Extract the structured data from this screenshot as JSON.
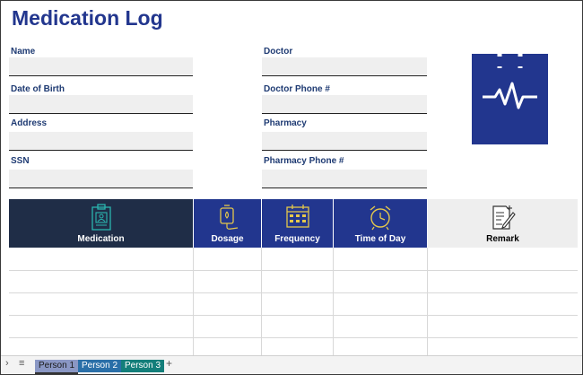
{
  "title": "Medication Log",
  "fields": {
    "name": "Name",
    "dob": "Date of Birth",
    "address": "Address",
    "ssn": "SSN",
    "doctor": "Doctor",
    "doctor_phone": "Doctor Phone #",
    "pharmacy": "Pharmacy",
    "pharmacy_phone": "Pharmacy Phone #"
  },
  "table": {
    "columns": [
      "Medication",
      "Dosage",
      "Frequency",
      "Time of Day",
      "Remark"
    ]
  },
  "sheets": {
    "tabs": [
      "Person 1",
      "Person 2",
      "Person 3"
    ],
    "add": "+"
  },
  "colors": {
    "navy": "#22368e",
    "dark_header": "#1f2d47",
    "gold": "#e5c84b",
    "teal": "#2bb5b0",
    "tab_active": "#8a97c4",
    "tab_blue": "#2a6fa8",
    "tab_teal": "#137e7a"
  }
}
